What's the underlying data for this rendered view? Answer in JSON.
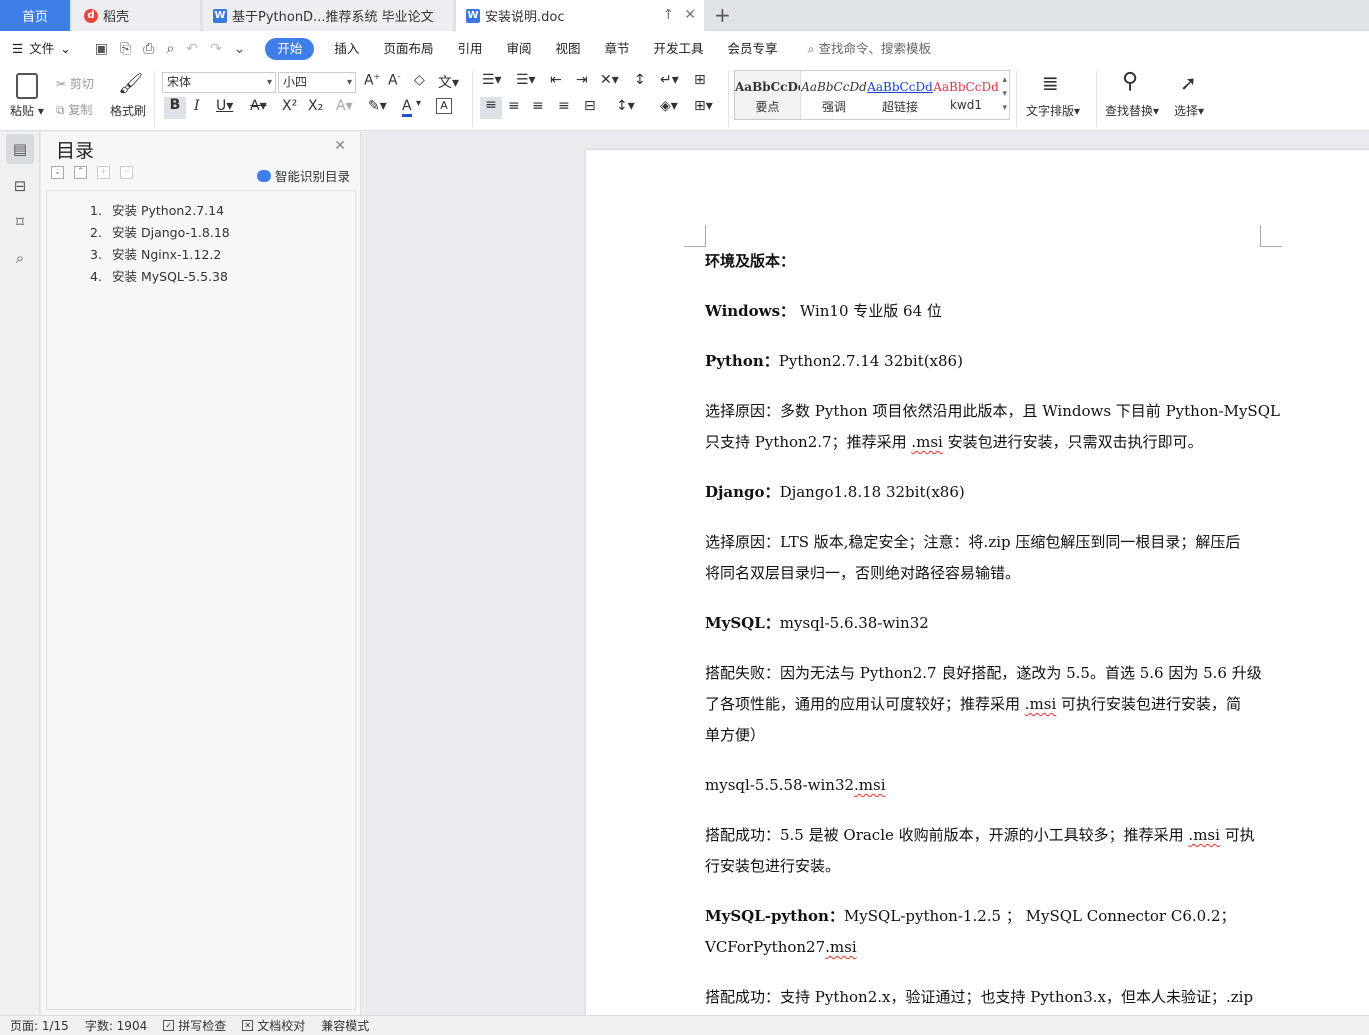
{
  "tabs": {
    "home": "首页",
    "daoke": "稻壳",
    "doc1": "基于PythonD...推荐系统 毕业论文",
    "doc2": "安装说明.doc"
  },
  "menu": {
    "file": "文件",
    "items": [
      "开始",
      "插入",
      "页面布局",
      "引用",
      "审阅",
      "视图",
      "章节",
      "开发工具",
      "会员专享"
    ],
    "search": "查找命令、搜索模板"
  },
  "ribbon": {
    "paste": "粘贴",
    "cut": "剪切",
    "copy": "复制",
    "format_painter": "格式刷",
    "font_name": "宋体",
    "font_size": "小四",
    "styles": [
      {
        "sample": "AaBbCcDd",
        "name": "要点"
      },
      {
        "sample": "AaBbCcDd",
        "name": "强调"
      },
      {
        "sample": "AaBbCcDd",
        "name": "超链接"
      },
      {
        "sample": "AaBbCcDd",
        "name": "kwd1"
      }
    ],
    "text_layout": "文字排版",
    "find_replace": "查找替换",
    "select": "选择"
  },
  "toc": {
    "title": "目录",
    "smart": "智能识别目录",
    "items": [
      {
        "num": "1.",
        "label": "安装 Python2.7.14"
      },
      {
        "num": "2.",
        "label": "安装 Django-1.8.18"
      },
      {
        "num": "3.",
        "label": "安装 Nginx-1.12.2"
      },
      {
        "num": "4.",
        "label": "安装 MySQL-5.5.38"
      }
    ]
  },
  "document": {
    "heading": "环境及版本：",
    "windows_label": "Windows：",
    "windows_value": " Win10   专业版   64 位",
    "python_label": "Python：",
    "python_value": "Python2.7.14 32bit(x86)",
    "python_reason_1": "选择原因：多数 Python 项目依然沿用此版本，且 Windows 下目前 Python-MySQL",
    "python_reason_2a": "只支持 Python2.7；推荐采用 ",
    "python_reason_2b": ".msi",
    "python_reason_2c": " 安装包进行安装，只需双击执行即可。",
    "django_label": "Django：",
    "django_value": "Django1.8.18 32bit(x86)",
    "django_reason_1": "选择原因：LTS 版本,稳定安全；注意：将.zip 压缩包解压到同一根目录；解压后",
    "django_reason_2": "将同名双层目录归一，否则绝对路径容易输错。",
    "mysql_label": "MySQL：",
    "mysql_value": "mysql-5.6.38-win32",
    "mysql_fail_1": "搭配失败：因为无法与 Python2.7 良好搭配，遂改为 5.5。首选 5.6 因为 5.6 升级",
    "mysql_fail_2a": "了各项性能，通用的应用认可度较好；推荐采用 ",
    "mysql_fail_2b": ".msi",
    "mysql_fail_2c": " 可执行安装包进行安装，简",
    "mysql_fail_3": "单方便）",
    "mysql_file_a": "mysql-5.5.58-win32",
    "mysql_file_b": ".msi",
    "mysql_ok_1a": "搭配成功：5.5 是被 Oracle 收购前版本，开源的小工具较多；推荐采用 ",
    "mysql_ok_1b": ".msi",
    "mysql_ok_1c": " 可执",
    "mysql_ok_2": "行安装包进行安装。",
    "mysqlpy_label": "MySQL-python：",
    "mysqlpy_value": "MySQL-python-1.2.5  ；  MySQL Connector C6.0.2；",
    "mysqlpy_vc_a": "VCForPython27",
    "mysqlpy_vc_b": ".msi",
    "last_line": "搭配成功：支持 Python2.x，验证通过；也支持 Python3.x，但本人未验证；.zip"
  },
  "status": {
    "page": "页面: 1/15",
    "words": "字数: 1904",
    "spell": "拼写检查",
    "proof": "文档校对",
    "compat": "兼容模式"
  },
  "colors": {
    "accent": "#3f7ee8",
    "squiggle": "#e33333"
  }
}
